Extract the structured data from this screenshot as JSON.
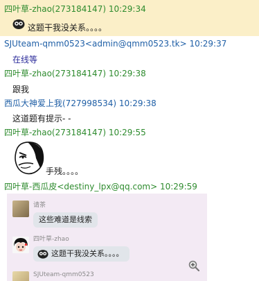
{
  "messages": [
    {
      "sender": "四叶草-zhao(273184147) 10:29:34",
      "text": "这题干我没关系。。。。"
    },
    {
      "sender": "SJUteam-qmm0523<admin@qmm0523.tk> 10:29:37",
      "text": "在线等"
    },
    {
      "sender": "四叶草-zhao(273184147) 10:29:38",
      "text": "跟我"
    },
    {
      "sender": "西瓜大神爱上我(727998534) 10:29:38",
      "text": "这道题有提示- -"
    },
    {
      "sender": "四叶草-zhao(273184147) 10:29:55",
      "text": "手残。。。。"
    },
    {
      "sender": "四叶草-西瓜皮<destiny_lpx@qq.com> 10:29:59",
      "text": ""
    }
  ],
  "screenshot": {
    "rows": [
      {
        "name": "请茶",
        "text": "这些难道是线索"
      },
      {
        "name": "四叶草-zhao",
        "text": "这题干我没关系。。。。"
      },
      {
        "name": "SJUteam-qmm0523",
        "text": ""
      }
    ]
  },
  "icons": {
    "owl": "owl-emoticon-icon",
    "meme": "rage-face-icon",
    "zoom": "zoom-in-icon"
  },
  "colors": {
    "highlight": "#fbefc8",
    "green_sender": "#2e8b2e",
    "blue_sender": "#1f5fa6",
    "screenshot_bg": "#f3eaf4"
  }
}
